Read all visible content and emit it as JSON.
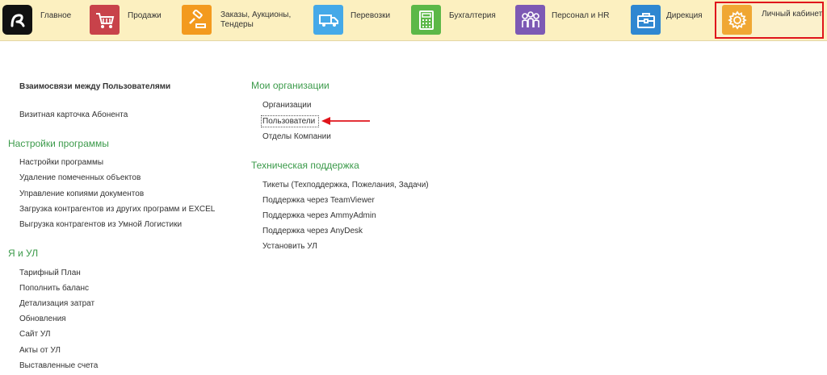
{
  "nav": {
    "items": [
      {
        "label": "Главное",
        "icon": "logo-icon",
        "color": "#111111"
      },
      {
        "label": "Продажи",
        "icon": "cart-icon",
        "color": "#c8424a"
      },
      {
        "label": "Заказы,  Аукционы,\nТендеры",
        "icon": "auction-icon",
        "color": "#f39a1e"
      },
      {
        "label": "Перевозки",
        "icon": "truck-icon",
        "color": "#45a9e8"
      },
      {
        "label": "Бухгалтерия",
        "icon": "calculator-icon",
        "color": "#5cb848"
      },
      {
        "label": "Персонал и HR",
        "icon": "people-icon",
        "color": "#7d59b4"
      },
      {
        "label": "Дирекция",
        "icon": "briefcase-icon",
        "color": "#2f87d1"
      },
      {
        "label": "Личный кабинет",
        "icon": "gear-icon",
        "color": "#f0a733"
      }
    ],
    "active_index": 7,
    "active_border_color": "#e0141b"
  },
  "left": {
    "top_links": [
      {
        "label": "Взаимосвязи между Пользователями",
        "bold": true
      },
      {
        "label": "Визитная карточка Абонента",
        "bold": false
      }
    ],
    "settings": {
      "title": "Настройки программы",
      "links": [
        "Настройки программы",
        "Удаление помеченных объектов",
        "Управление копиями документов",
        "Загрузка контрагентов из других программ и EXCEL",
        "Выгрузка контрагентов из Умной Логистики"
      ]
    },
    "ul": {
      "title": "Я и УЛ",
      "links": [
        "Тарифный План",
        "Пополнить баланс",
        "Детализация затрат",
        "Обновления",
        "Сайт УЛ",
        "Акты от УЛ",
        "Выставленные счета"
      ]
    }
  },
  "right": {
    "orgs": {
      "title": "Мои организации",
      "links": [
        "Организации",
        "Пользователи",
        "Отделы Компании"
      ],
      "focused_index": 1
    },
    "support": {
      "title": "Техническая поддержка",
      "links": [
        "Тикеты (Техподдержка, Пожелания, Задачи)",
        "Поддержка через TeamViewer",
        "Поддержка через AmmyAdmin",
        "Поддержка через AnyDesk",
        "Установить УЛ"
      ]
    }
  },
  "colors": {
    "topbar": "#fcf0c0",
    "section_title": "#3b9a4a",
    "link_text": "#333333",
    "annotation_arrow": "#e0141b"
  }
}
